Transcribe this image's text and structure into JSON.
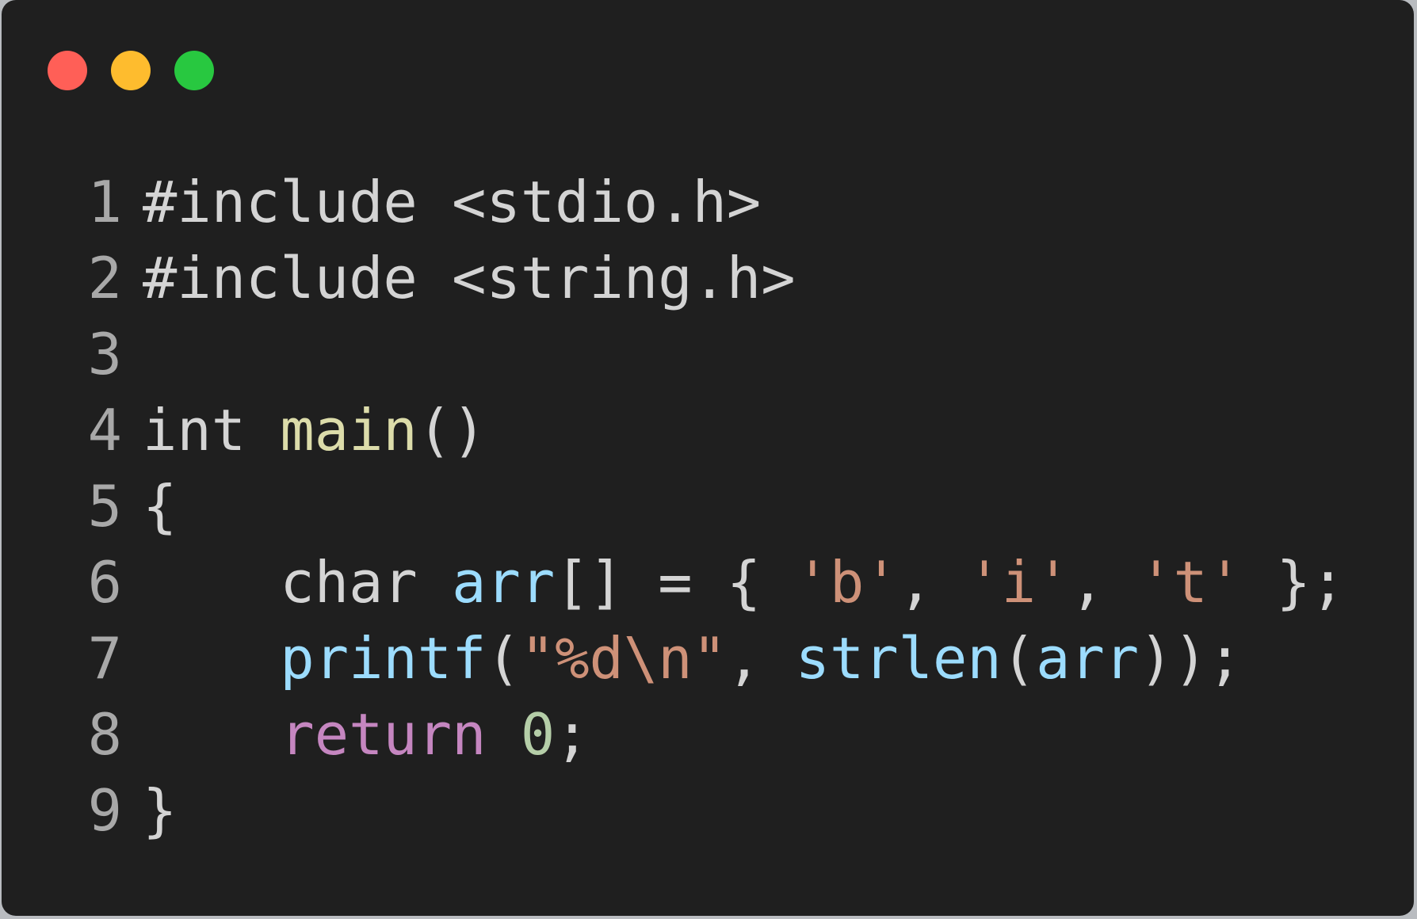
{
  "window": {
    "controls": [
      {
        "name": "close",
        "color": "#ff5f57"
      },
      {
        "name": "minimize",
        "color": "#febc2e"
      },
      {
        "name": "zoom",
        "color": "#28c840"
      }
    ]
  },
  "code": {
    "lines": [
      {
        "number": "1",
        "tokens": [
          {
            "text": "#include <stdio.h>",
            "type": "pl"
          }
        ]
      },
      {
        "number": "2",
        "tokens": [
          {
            "text": "#include <string.h>",
            "type": "pl"
          }
        ]
      },
      {
        "number": "3",
        "tokens": []
      },
      {
        "number": "4",
        "tokens": [
          {
            "text": "int ",
            "type": "kw"
          },
          {
            "text": "main",
            "type": "fn"
          },
          {
            "text": "()",
            "type": "pl"
          }
        ]
      },
      {
        "number": "5",
        "tokens": [
          {
            "text": "{",
            "type": "pl"
          }
        ]
      },
      {
        "number": "6",
        "tokens": [
          {
            "text": "    char ",
            "type": "kw"
          },
          {
            "text": "arr",
            "type": "id"
          },
          {
            "text": "[] = { ",
            "type": "pl"
          },
          {
            "text": "'b'",
            "type": "str"
          },
          {
            "text": ", ",
            "type": "pl"
          },
          {
            "text": "'i'",
            "type": "str"
          },
          {
            "text": ", ",
            "type": "pl"
          },
          {
            "text": "'t'",
            "type": "str"
          },
          {
            "text": " };",
            "type": "pl"
          }
        ]
      },
      {
        "number": "7",
        "tokens": [
          {
            "text": "    ",
            "type": "pl"
          },
          {
            "text": "printf",
            "type": "id"
          },
          {
            "text": "(",
            "type": "pl"
          },
          {
            "text": "\"%d\\n\"",
            "type": "str"
          },
          {
            "text": ", ",
            "type": "pl"
          },
          {
            "text": "strlen",
            "type": "id"
          },
          {
            "text": "(",
            "type": "pl"
          },
          {
            "text": "arr",
            "type": "id"
          },
          {
            "text": "));",
            "type": "pl"
          }
        ]
      },
      {
        "number": "8",
        "tokens": [
          {
            "text": "    ",
            "type": "pl"
          },
          {
            "text": "return ",
            "type": "ret"
          },
          {
            "text": "0",
            "type": "num"
          },
          {
            "text": ";",
            "type": "pl"
          }
        ]
      },
      {
        "number": "9",
        "tokens": [
          {
            "text": "}",
            "type": "pl"
          }
        ]
      }
    ]
  }
}
